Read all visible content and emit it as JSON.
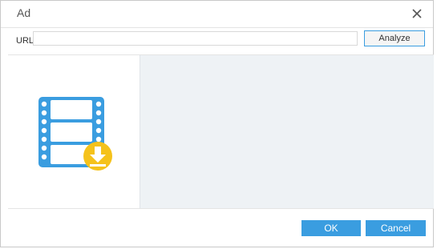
{
  "dialog": {
    "title": "Ad",
    "close_icon": "close-icon"
  },
  "url_bar": {
    "label": "URL",
    "value": "",
    "analyze_label": "Analyze"
  },
  "preview": {
    "icon": "video-download-icon",
    "colors": {
      "film": "#3a9de0",
      "badge": "#f5c21b"
    }
  },
  "footer": {
    "ok_label": "OK",
    "cancel_label": "Cancel"
  },
  "colors": {
    "accent": "#3a9de0",
    "panel_bg": "#eef2f5"
  }
}
